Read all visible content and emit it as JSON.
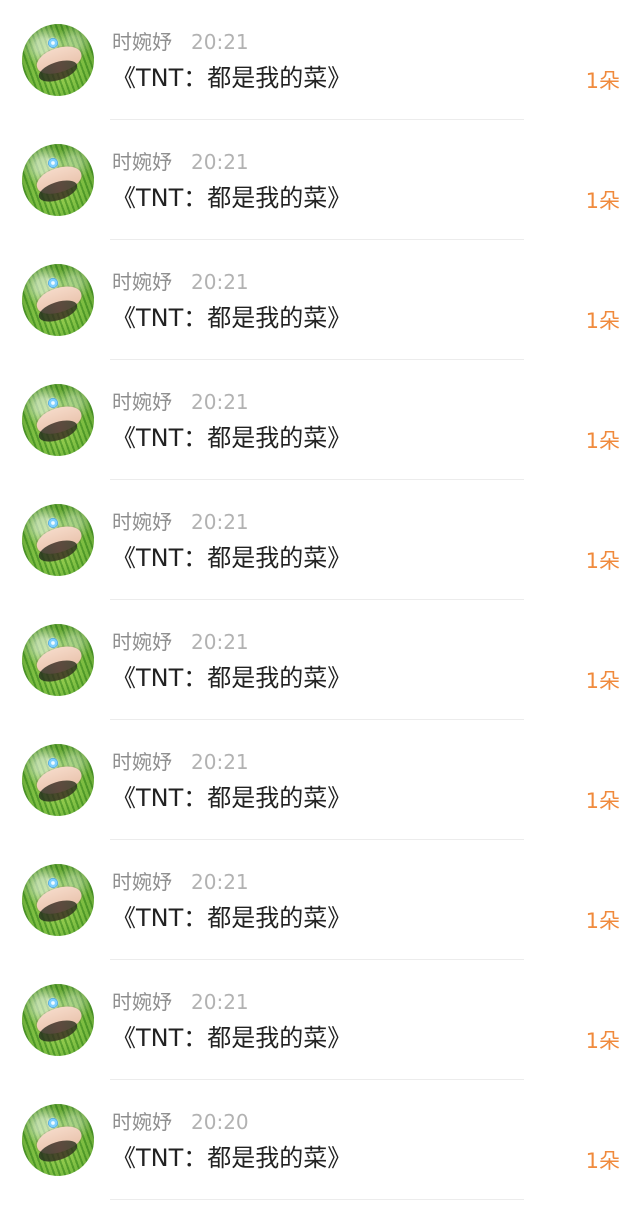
{
  "items": [
    {
      "name": "时婉妤",
      "time": "20:21",
      "title": "《TNT：都是我的菜》",
      "amount": "1朵"
    },
    {
      "name": "时婉妤",
      "time": "20:21",
      "title": "《TNT：都是我的菜》",
      "amount": "1朵"
    },
    {
      "name": "时婉妤",
      "time": "20:21",
      "title": "《TNT：都是我的菜》",
      "amount": "1朵"
    },
    {
      "name": "时婉妤",
      "time": "20:21",
      "title": "《TNT：都是我的菜》",
      "amount": "1朵"
    },
    {
      "name": "时婉妤",
      "time": "20:21",
      "title": "《TNT：都是我的菜》",
      "amount": "1朵"
    },
    {
      "name": "时婉妤",
      "time": "20:21",
      "title": "《TNT：都是我的菜》",
      "amount": "1朵"
    },
    {
      "name": "时婉妤",
      "time": "20:21",
      "title": "《TNT：都是我的菜》",
      "amount": "1朵"
    },
    {
      "name": "时婉妤",
      "time": "20:21",
      "title": "《TNT：都是我的菜》",
      "amount": "1朵"
    },
    {
      "name": "时婉妤",
      "time": "20:21",
      "title": "《TNT：都是我的菜》",
      "amount": "1朵"
    },
    {
      "name": "时婉妤",
      "time": "20:20",
      "title": "《TNT：都是我的菜》",
      "amount": "1朵"
    }
  ],
  "colors": {
    "amount": "#f08a3c",
    "name": "#8f8f8f",
    "time": "#b2b2b2",
    "title": "#222222"
  },
  "icons": {
    "avatar": "user-avatar-photo"
  }
}
